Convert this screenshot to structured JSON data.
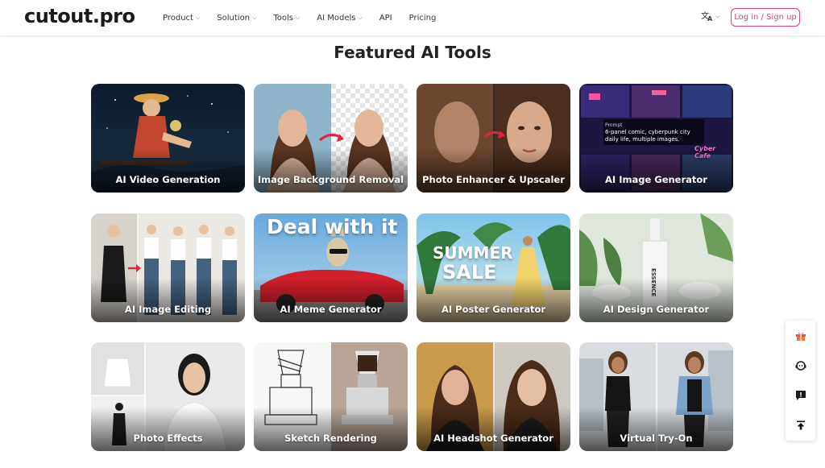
{
  "header": {
    "logo": "cutout.pro",
    "nav": [
      {
        "label": "Product",
        "dropdown": true
      },
      {
        "label": "Solution",
        "dropdown": true
      },
      {
        "label": "Tools",
        "dropdown": true
      },
      {
        "label": "AI Models",
        "dropdown": true
      },
      {
        "label": "API",
        "dropdown": false
      },
      {
        "label": "Pricing",
        "dropdown": false
      }
    ],
    "language_icon": "translate-icon",
    "login_label": "Log in / Sign up"
  },
  "section": {
    "title": "Featured AI Tools"
  },
  "cards": [
    {
      "label": "AI Video Generation"
    },
    {
      "label": "Image Background Removal"
    },
    {
      "label": "Photo Enhancer & Upscaler"
    },
    {
      "label": "AI Image Generator",
      "prompt_title": "Prompt",
      "prompt_text": "6-panel comic, cyberpunk city daily life, multiple images.",
      "sign_text": "Cyber Cafe"
    },
    {
      "label": "AI Image Editing"
    },
    {
      "label": "AI Meme Generator",
      "overlay": "Deal with it"
    },
    {
      "label": "AI Poster Generator",
      "overlay_line1": "SUMMER",
      "overlay_line2": "SALE"
    },
    {
      "label": "AI Design Generator",
      "bottle_text": "ESSENCE"
    },
    {
      "label": "Photo Effects"
    },
    {
      "label": "Sketch Rendering"
    },
    {
      "label": "AI Headshot Generator"
    },
    {
      "label": "Virtual Try-On"
    }
  ],
  "floating_sidebar": [
    {
      "icon": "gift-icon"
    },
    {
      "icon": "support-icon"
    },
    {
      "icon": "feedback-icon"
    },
    {
      "icon": "back-to-top-icon"
    }
  ],
  "colors": {
    "accent": "#e0436b",
    "text": "#222222"
  }
}
